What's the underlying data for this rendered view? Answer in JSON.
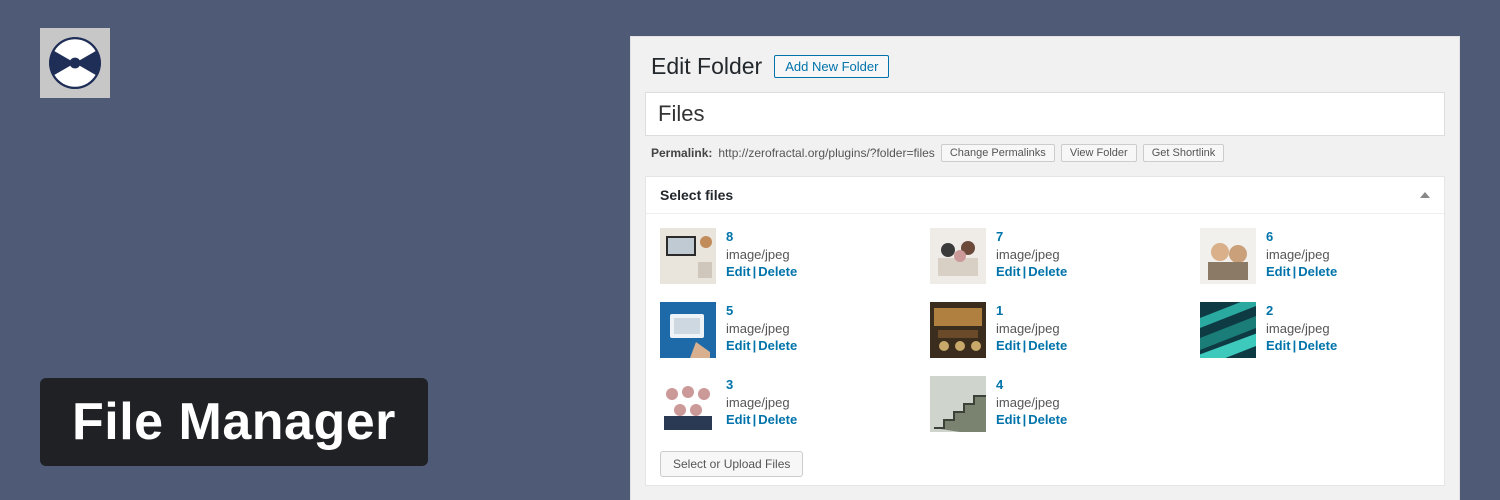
{
  "app": {
    "title": "File Manager"
  },
  "wp": {
    "page_heading": "Edit Folder",
    "add_new_label": "Add New Folder",
    "folder_name_value": "Files",
    "permalink": {
      "label": "Permalink:",
      "url": "http://zerofractal.org/plugins/?folder=files",
      "buttons": {
        "change": "Change Permalinks",
        "view": "View Folder",
        "shortlink": "Get Shortlink"
      }
    },
    "metabox": {
      "title": "Select files",
      "upload_button": "Select or Upload Files",
      "edit_label": "Edit",
      "delete_label": "Delete"
    },
    "files": [
      {
        "id": "8",
        "mime": "image/jpeg"
      },
      {
        "id": "7",
        "mime": "image/jpeg"
      },
      {
        "id": "6",
        "mime": "image/jpeg"
      },
      {
        "id": "5",
        "mime": "image/jpeg"
      },
      {
        "id": "1",
        "mime": "image/jpeg"
      },
      {
        "id": "2",
        "mime": "image/jpeg"
      },
      {
        "id": "3",
        "mime": "image/jpeg"
      },
      {
        "id": "4",
        "mime": "image/jpeg"
      }
    ]
  }
}
